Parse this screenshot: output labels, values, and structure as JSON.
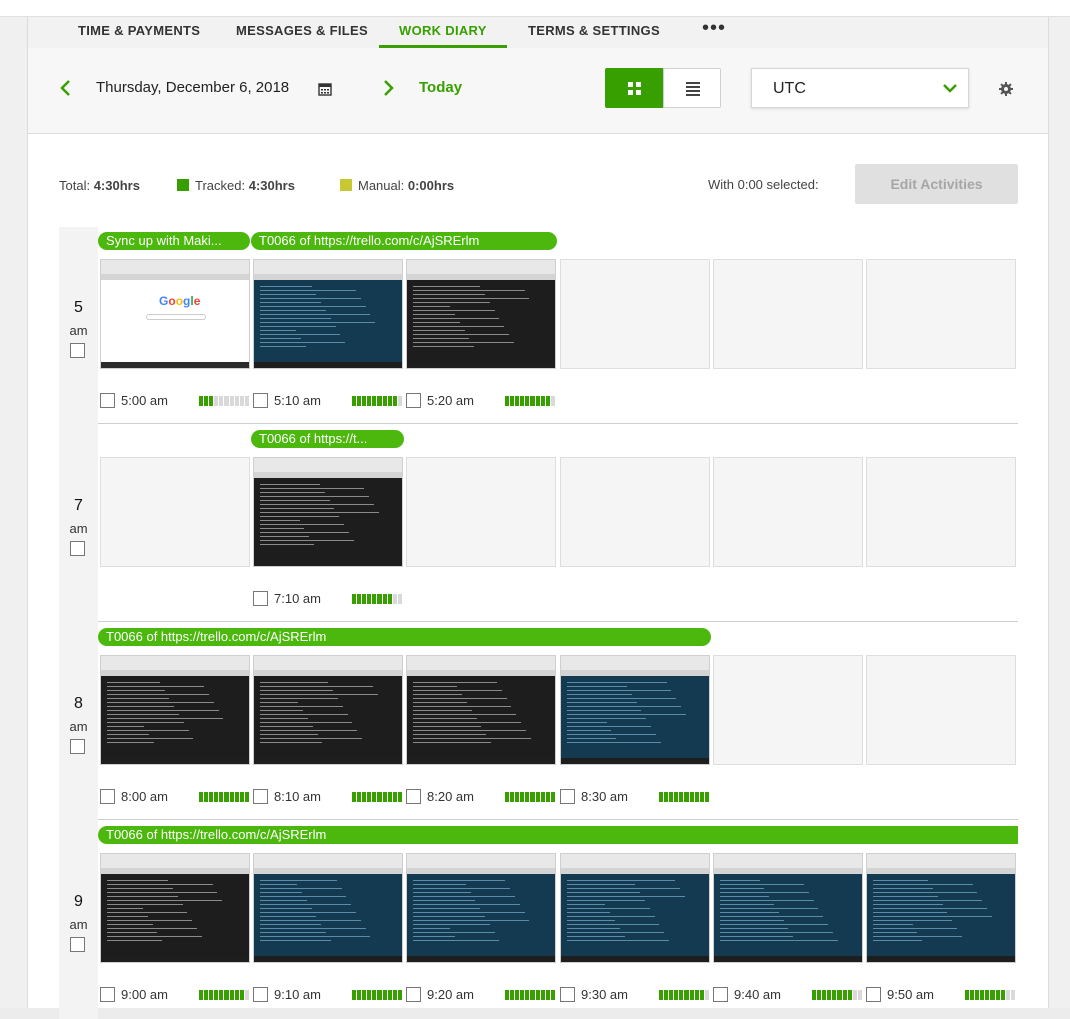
{
  "tabs": [
    "TIME & PAYMENTS",
    "MESSAGES & FILES",
    "WORK DIARY",
    "TERMS & SETTINGS"
  ],
  "tabs_more": "•••",
  "toolbar": {
    "date": "Thursday, December 6, 2018",
    "today": "Today",
    "timezone": "UTC"
  },
  "summary": {
    "total_label": "Total:",
    "total_value": "4:30hrs",
    "tracked_label": "Tracked:",
    "tracked_value": "4:30hrs",
    "manual_label": "Manual:",
    "manual_value": "0:00hrs",
    "with_selected": "With 0:00 selected:",
    "edit_button": "Edit Activities"
  },
  "colors": {
    "accent": "#37a000",
    "memo": "#4cb80d",
    "manual": "#c8c832"
  },
  "hours": [
    {
      "num": "5",
      "ampm": "am",
      "memos": [
        "Sync up with Maki...",
        "T0066 of https://trello.com/c/AjSRErlm"
      ],
      "slots": [
        {
          "time": "5:00 am",
          "kind": "google",
          "activity": 3
        },
        {
          "time": "5:10 am",
          "kind": "blue",
          "activity": 9
        },
        {
          "time": "5:20 am",
          "kind": "dark",
          "activity": 9
        },
        null,
        null,
        null
      ]
    },
    {
      "num": "7",
      "ampm": "am",
      "memos": [
        "T0066 of https://t..."
      ],
      "slots": [
        null,
        {
          "time": "7:10 am",
          "kind": "dark",
          "activity": 8
        },
        null,
        null,
        null,
        null
      ]
    },
    {
      "num": "8",
      "ampm": "am",
      "memos": [
        "T0066 of https://trello.com/c/AjSRErlm"
      ],
      "slots": [
        {
          "time": "8:00 am",
          "kind": "dark",
          "activity": 10
        },
        {
          "time": "8:10 am",
          "kind": "dark",
          "activity": 10
        },
        {
          "time": "8:20 am",
          "kind": "dark",
          "activity": 10
        },
        {
          "time": "8:30 am",
          "kind": "blue",
          "activity": 10
        },
        null,
        null
      ]
    },
    {
      "num": "9",
      "ampm": "am",
      "memos": [
        "T0066 of https://trello.com/c/AjSRErlm"
      ],
      "slots": [
        {
          "time": "9:00 am",
          "kind": "dark",
          "activity": 9
        },
        {
          "time": "9:10 am",
          "kind": "blue",
          "activity": 10
        },
        {
          "time": "9:20 am",
          "kind": "blue",
          "activity": 10
        },
        {
          "time": "9:30 am",
          "kind": "blue",
          "activity": 9
        },
        {
          "time": "9:40 am",
          "kind": "blue",
          "activity": 8
        },
        {
          "time": "9:50 am",
          "kind": "blue",
          "activity": 8
        }
      ]
    }
  ]
}
